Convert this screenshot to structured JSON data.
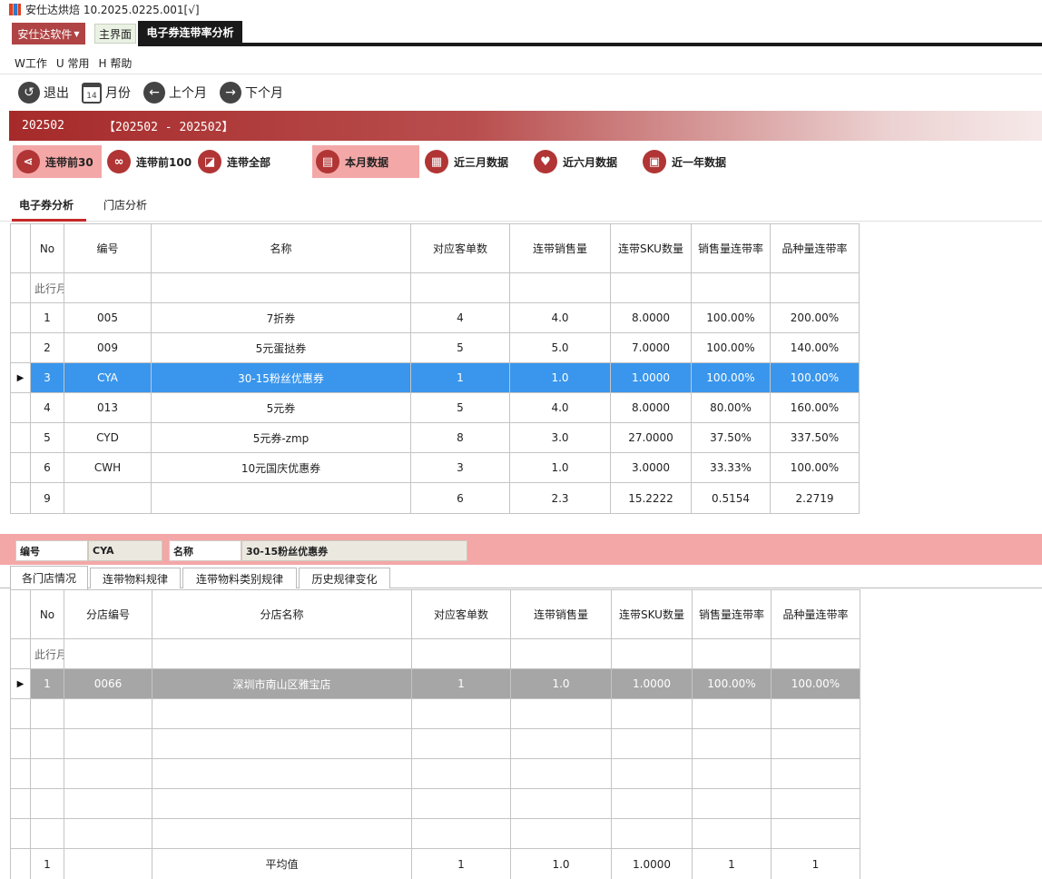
{
  "window": {
    "title": "安仕达烘焙  10.2025.0225.001[√]"
  },
  "top": {
    "company": "安仕达软件",
    "home_tab": "主界面",
    "active_tab": "电子券连带率分析"
  },
  "menu": [
    "W工作",
    "U 常用",
    "H 帮助"
  ],
  "toolbar": {
    "exit": "退出",
    "month": "月份",
    "prev": "上个月",
    "next": "下个月",
    "cal_day": "14"
  },
  "banner": {
    "current": "202502",
    "range": "【202502 - 202502】"
  },
  "filters": {
    "top30": "连带前30",
    "top100": "连带前100",
    "all": "连带全部",
    "this_month": "本月数据",
    "three_months": "近三月数据",
    "six_months": "近六月数据",
    "one_year": "近一年数据"
  },
  "subtabs": {
    "coupon": "电子券分析",
    "store": "门店分析"
  },
  "grid1": {
    "headers": [
      "No",
      "编号",
      "名称",
      "对应客单数",
      "连带销售量",
      "连带SKU数量",
      "销售量连带率",
      "品种量连带率"
    ],
    "filter_hint": "此行月",
    "rows": [
      [
        "1",
        "005",
        "7折券",
        "4",
        "4.0",
        "8.0000",
        "100.00%",
        "200.00%"
      ],
      [
        "2",
        "009",
        "5元蛋挞券",
        "5",
        "5.0",
        "7.0000",
        "100.00%",
        "140.00%"
      ],
      [
        "3",
        "CYA",
        "30-15粉丝优惠券",
        "1",
        "1.0",
        "1.0000",
        "100.00%",
        "100.00%"
      ],
      [
        "4",
        "013",
        "5元券",
        "5",
        "4.0",
        "8.0000",
        "80.00%",
        "160.00%"
      ],
      [
        "5",
        "CYD",
        "5元券-zmp",
        "8",
        "3.0",
        "27.0000",
        "37.50%",
        "337.50%"
      ],
      [
        "6",
        "CWH",
        "10元国庆优惠券",
        "3",
        "1.0",
        "3.0000",
        "33.33%",
        "100.00%"
      ]
    ],
    "selected_row": 2,
    "summary": [
      "9",
      "",
      "",
      "6",
      "2.3",
      "15.2222",
      "0.5154",
      "2.2719"
    ]
  },
  "detail": {
    "code_label": "编号",
    "code_value": "CYA",
    "name_label": "名称",
    "name_value": "30-15粉丝优惠券",
    "tabs": [
      "各门店情况",
      "连带物料规律",
      "连带物料类别规律",
      "历史规律变化"
    ]
  },
  "grid2": {
    "headers": [
      "No",
      "分店编号",
      "分店名称",
      "对应客单数",
      "连带销售量",
      "连带SKU数量",
      "销售量连带率",
      "品种量连带率"
    ],
    "filter_hint": "此行月",
    "rows": [
      [
        "1",
        "0066",
        "深圳市南山区雅宝店",
        "1",
        "1.0",
        "1.0000",
        "100.00%",
        "100.00%"
      ]
    ],
    "summary": [
      "1",
      "",
      "平均值",
      "1",
      "1.0",
      "1.0000",
      "1",
      "1"
    ]
  },
  "colors": {
    "accent": "#b13535",
    "selection_blue": "#3a96ec",
    "highlight_pink": "#f4a7a7"
  }
}
